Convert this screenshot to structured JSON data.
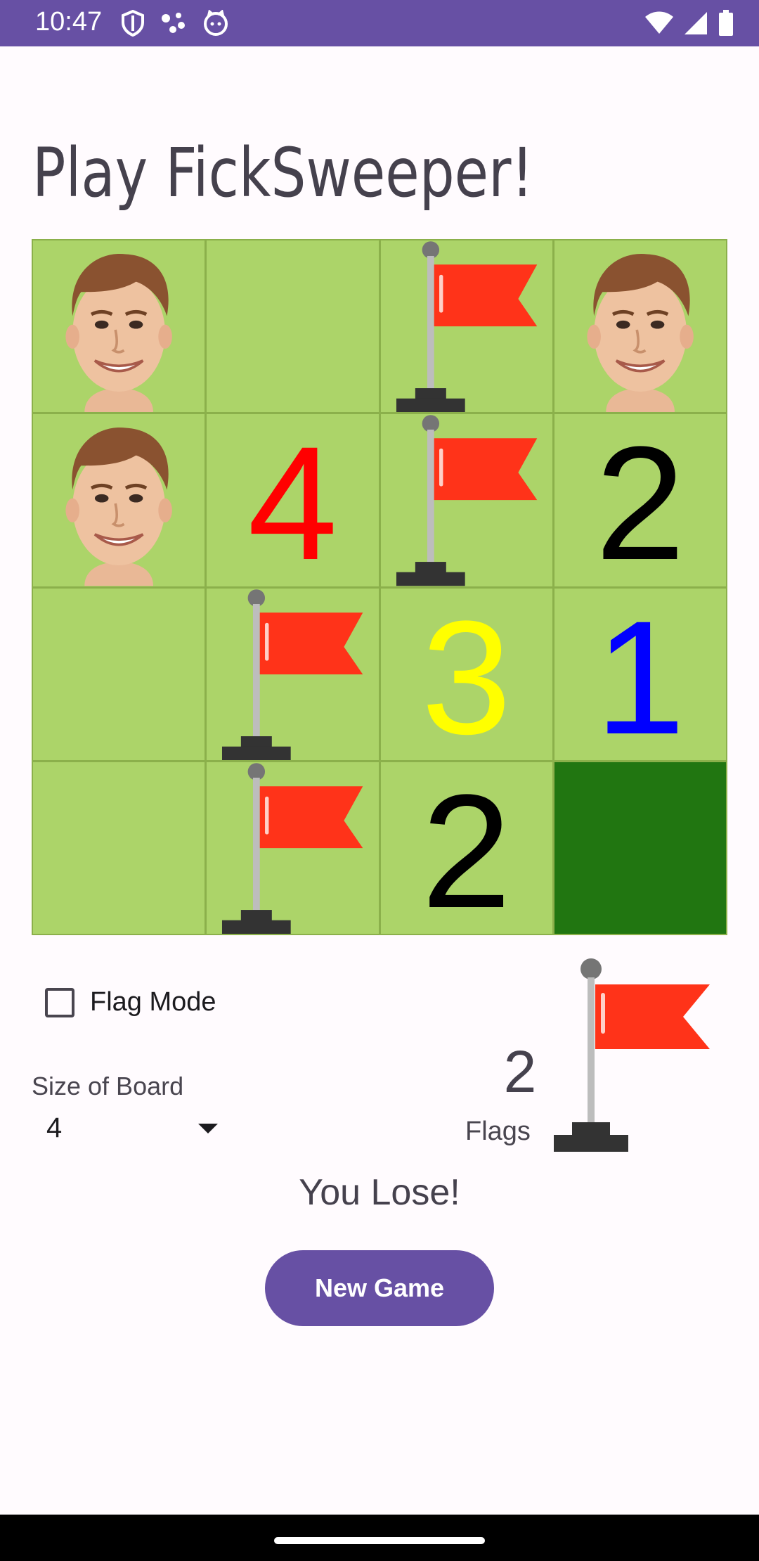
{
  "status_bar": {
    "time": "10:47",
    "left_icons": [
      "shield-icon",
      "assistant-dots-icon",
      "cat-face-icon"
    ],
    "right_icons": [
      "wifi-icon",
      "signal-icon",
      "battery-icon"
    ],
    "background": "#6750a4"
  },
  "page": {
    "title": "Play FickSweeper!"
  },
  "board": {
    "size": 4,
    "cells": [
      [
        {
          "type": "face"
        },
        {
          "type": "empty"
        },
        {
          "type": "flag"
        },
        {
          "type": "face"
        }
      ],
      [
        {
          "type": "face"
        },
        {
          "type": "number",
          "value": "4",
          "color": "#ff0000"
        },
        {
          "type": "flag"
        },
        {
          "type": "number",
          "value": "2",
          "color": "#000000"
        }
      ],
      [
        {
          "type": "empty"
        },
        {
          "type": "flag"
        },
        {
          "type": "number",
          "value": "3",
          "color": "#ffff00"
        },
        {
          "type": "number",
          "value": "1",
          "color": "#0000ff"
        }
      ],
      [
        {
          "type": "empty"
        },
        {
          "type": "flag"
        },
        {
          "type": "number",
          "value": "2",
          "color": "#000000"
        },
        {
          "type": "unrevealed"
        }
      ]
    ],
    "colors": {
      "revealed": "#acd469",
      "unrevealed": "#217611",
      "grid": "#8bb04b"
    }
  },
  "controls": {
    "flag_mode_label": "Flag Mode",
    "flag_mode_checked": false,
    "size_label": "Size of Board",
    "size_value": "4",
    "flags_count": "2",
    "flags_label": "Flags"
  },
  "result": "You Lose!",
  "new_game_label": "New Game",
  "accent": "#6750a4"
}
